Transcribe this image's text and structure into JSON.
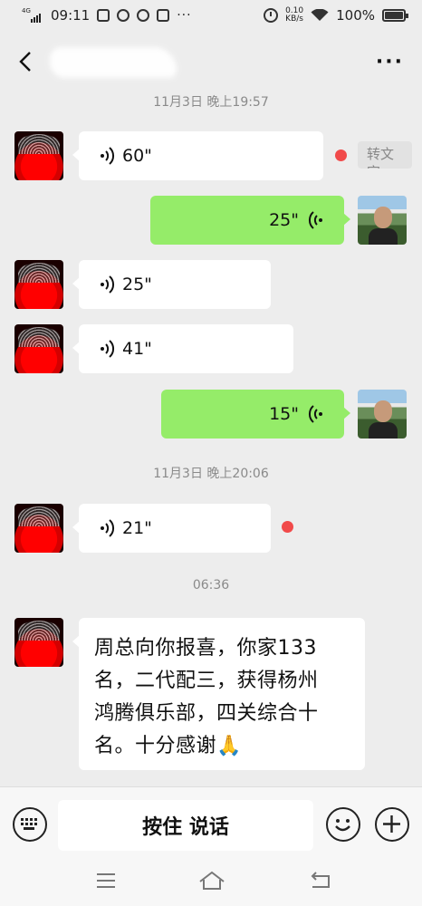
{
  "status_bar": {
    "network_label": "4G",
    "time": "09:11",
    "net_speed_value": "0.10",
    "net_speed_unit": "KB/s",
    "battery": "100%",
    "battery_level": 1.0
  },
  "header": {
    "contact_name": ""
  },
  "chat": {
    "timestamps": [
      "11月3日 晚上19:57",
      "11月3日 晚上20:06",
      "06:36"
    ],
    "voice_messages": [
      {
        "direction": "in",
        "duration": "60\"",
        "unread": true
      },
      {
        "direction": "out",
        "duration": "25\""
      },
      {
        "direction": "in",
        "duration": "25\"",
        "unread": false
      },
      {
        "direction": "in",
        "duration": "41\"",
        "unread": false
      },
      {
        "direction": "out",
        "duration": "15\""
      },
      {
        "direction": "in",
        "duration": "21\"",
        "unread": true
      }
    ],
    "convert_to_text_label": "转文字",
    "text_message_lines": [
      "周总向你报喜，你家133",
      "名，二代配三，获得杨州",
      "鸿腾俱乐部，四关综合十",
      "名。十分感谢🙏"
    ]
  },
  "input_bar": {
    "hold_to_talk_label": "按住 说话"
  },
  "icons": {
    "accent_green": "#95ec69",
    "unread_red": "#f14a4a"
  }
}
